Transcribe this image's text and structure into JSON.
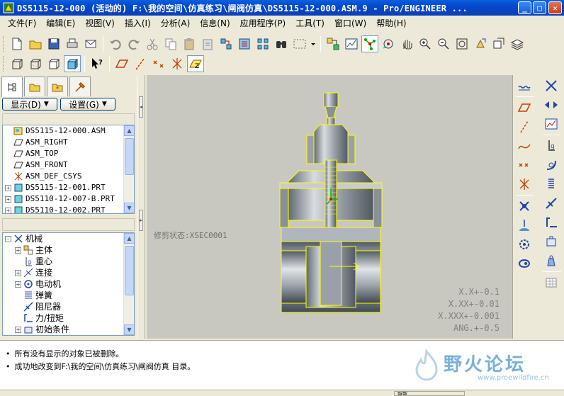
{
  "window": {
    "title": "DS5115-12-000 (活动的) F:\\我的空间\\仿真练习\\闸阀仿真\\DS5115-12-000.ASM.9 - Pro/ENGINEER ...",
    "min": "_",
    "max": "□",
    "close": "✕"
  },
  "menu": [
    "文件(F)",
    "编辑(E)",
    "视图(V)",
    "插入(I)",
    "分析(A)",
    "信息(N)",
    "应用程序(P)",
    "工具(T)",
    "窗口(W)",
    "帮助(H)"
  ],
  "left_panel": {
    "display_btn": "显示(D)",
    "settings_btn": "设置(G)",
    "model_tree": [
      {
        "label": "DS5115-12-000.ASM",
        "icon": "assembly-icon",
        "expander": ""
      },
      {
        "label": "ASM_RIGHT",
        "icon": "datum-plane-icon",
        "expander": ""
      },
      {
        "label": "ASM_TOP",
        "icon": "datum-plane-icon",
        "expander": ""
      },
      {
        "label": "ASM_FRONT",
        "icon": "datum-plane-icon",
        "expander": ""
      },
      {
        "label": "ASM_DEF_CSYS",
        "icon": "csys-icon",
        "expander": ""
      },
      {
        "label": "DS5115-12-001.PRT",
        "icon": "part-icon",
        "expander": "+"
      },
      {
        "label": "DS5110-12-007-B.PRT",
        "icon": "part-icon",
        "expander": "+"
      },
      {
        "label": "DS5110-12-002.PRT",
        "icon": "part-icon",
        "expander": "+"
      }
    ],
    "mech_tree": [
      {
        "label": "机械",
        "icon": "mechanism-icon",
        "expander": "-",
        "indent": 0
      },
      {
        "label": "主体",
        "icon": "body-icon",
        "expander": "+",
        "indent": 1
      },
      {
        "label": "重心",
        "icon": "gravity-icon",
        "expander": "",
        "indent": 1
      },
      {
        "label": "连接",
        "icon": "connection-icon",
        "expander": "+",
        "indent": 1
      },
      {
        "label": "电动机",
        "icon": "motor-icon",
        "expander": "+",
        "indent": 1
      },
      {
        "label": "弹簧",
        "icon": "spring-icon",
        "expander": "",
        "indent": 1
      },
      {
        "label": "阻尼器",
        "icon": "damper-icon",
        "expander": "",
        "indent": 1
      },
      {
        "label": "力/扭矩",
        "icon": "force-icon",
        "expander": "",
        "indent": 1
      },
      {
        "label": "初始条件",
        "icon": "initial-condition-icon",
        "expander": "+",
        "indent": 1
      }
    ]
  },
  "graphics": {
    "section_label": "修剪状态:XSEC0001",
    "tolerances": [
      "X.X+-0.1",
      "X.XX+-0.01",
      "X.XXX+-0.001",
      "ANG.+-0.5"
    ]
  },
  "messages": [
    "所有没有显示的对象已被删除。",
    "成功地改变到F:\\我的空间\\仿真练习\\闸阀仿真 目录。"
  ],
  "watermark": {
    "title": "野火论坛",
    "url": "www.proewildfire.cn"
  },
  "status": {
    "filter": "智能"
  },
  "colors": {
    "titlebar": "#0548c8",
    "graphics_bg": "#c8c8c0",
    "highlight": "#ffff00",
    "watermark": "#7ab0d8"
  }
}
